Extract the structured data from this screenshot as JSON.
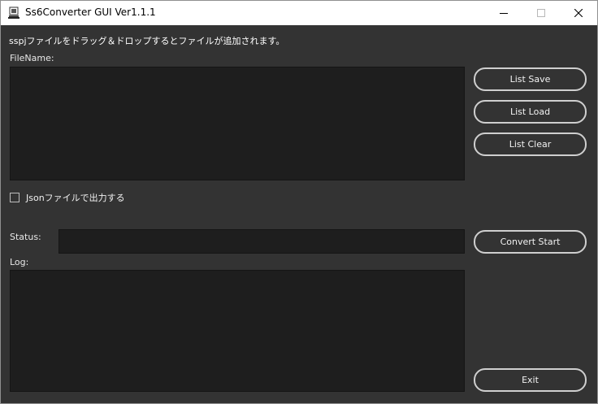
{
  "window": {
    "title": "Ss6Converter GUI Ver1.1.1",
    "controls": {
      "minimize": "minimize-icon",
      "maximize": "maximize-icon",
      "close": "close-icon"
    }
  },
  "main": {
    "instruction": "sspjファイルをドラッグ＆ドロップするとファイルが追加されます。",
    "filename_label": "FileName:",
    "json_checkbox": {
      "label": "Jsonファイルで出力する",
      "checked": false
    },
    "status_label": "Status:",
    "status_value": "",
    "log_label": "Log:",
    "log_value": ""
  },
  "buttons": {
    "list_save": "List Save",
    "list_load": "List Load",
    "list_clear": "List Clear",
    "convert_start": "Convert Start",
    "exit": "Exit"
  },
  "colors": {
    "background": "#333333",
    "panel": "#1e1e1e",
    "button_border": "#cfcfcf",
    "text": "#f0f0f0"
  }
}
